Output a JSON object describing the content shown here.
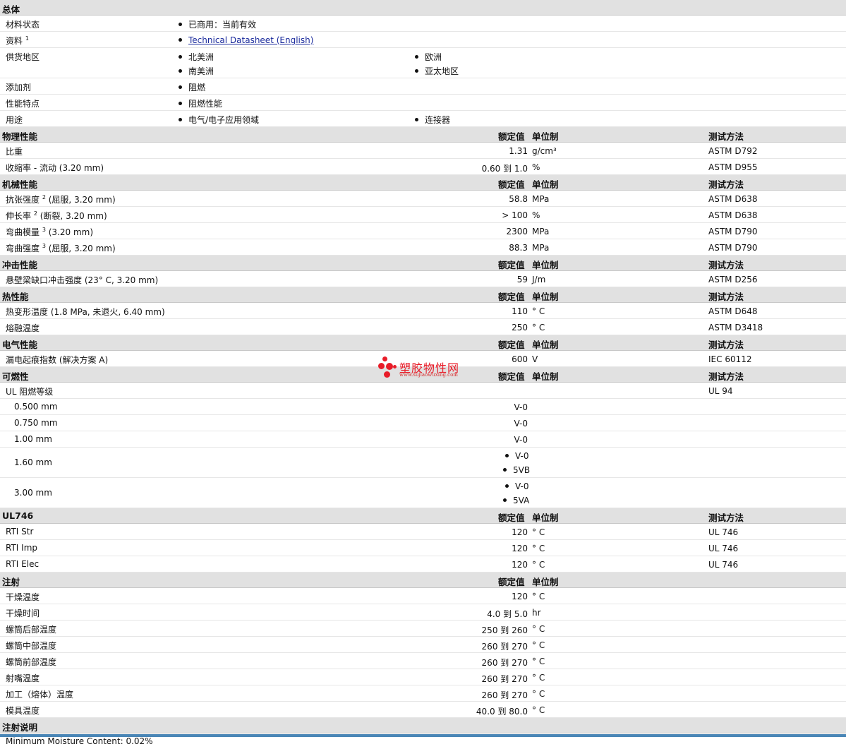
{
  "general": {
    "title": "总体",
    "status_label": "材料状态",
    "status_value": "已商用：当前有效",
    "docs_label": "资料",
    "docs_note": "1",
    "docs_link": "Technical Datasheet (English)",
    "supply_label": "供货地区",
    "supply": [
      "北美洲",
      "欧洲",
      "南美洲",
      "亚太地区"
    ],
    "additive_label": "添加剂",
    "additive_value": "阻燃",
    "feature_label": "性能特点",
    "feature_value": "阻燃性能",
    "use_label": "用途",
    "use_values": [
      "电气/电子应用领域",
      "连接器"
    ]
  },
  "headers": {
    "rated": "额定值",
    "unit": "单位制",
    "test": "测试方法"
  },
  "physical": {
    "title": "物理性能",
    "rows": [
      {
        "label": "比重",
        "value": "1.31",
        "unit": "g/cm³",
        "test": "ASTM D792"
      },
      {
        "label": "收缩率 - 流动  (3.20 mm)",
        "value": "0.60 到  1.0",
        "unit": "%",
        "test": "ASTM D955"
      }
    ]
  },
  "mechanical": {
    "title": "机械性能",
    "rows": [
      {
        "label_a": "抗张强度",
        "note": "2",
        "label_b": " (屈服, 3.20 mm)",
        "value": "58.8",
        "unit": "MPa",
        "test": "ASTM D638"
      },
      {
        "label_a": "伸长率",
        "note": "2",
        "label_b": " (断裂, 3.20 mm)",
        "value": "> 100",
        "unit": "%",
        "test": "ASTM D638"
      },
      {
        "label_a": "弯曲模量",
        "note": "3",
        "label_b": " (3.20 mm)",
        "value": "2300",
        "unit": "MPa",
        "test": "ASTM D790"
      },
      {
        "label_a": "弯曲强度",
        "note": "3",
        "label_b": " (屈服, 3.20 mm)",
        "value": "88.3",
        "unit": "MPa",
        "test": "ASTM D790"
      }
    ]
  },
  "impact": {
    "title": "冲击性能",
    "rows": [
      {
        "label": "悬壁梁缺口冲击强度  (23°  C, 3.20 mm)",
        "value": "59",
        "unit": "J/m",
        "test": "ASTM D256"
      }
    ]
  },
  "thermal": {
    "title": "热性能",
    "rows": [
      {
        "label": "热变形温度  (1.8 MPa, 未退火, 6.40 mm)",
        "value": "110",
        "unit": "°  C",
        "test": "ASTM D648"
      },
      {
        "label": "熔融温度",
        "value": "250",
        "unit": "°  C",
        "test": "ASTM D3418"
      }
    ]
  },
  "electrical": {
    "title": "电气性能",
    "rows": [
      {
        "label": "漏电起痕指数  (解决方案  A)",
        "value": "600",
        "unit": "V",
        "test": "IEC 60112"
      }
    ]
  },
  "flammability": {
    "title": "可燃性",
    "main_label": "UL 阻燃等级",
    "main_test": "UL 94",
    "rows": [
      {
        "label": "0.500 mm",
        "value": "V-0"
      },
      {
        "label": "0.750 mm",
        "value": "V-0"
      },
      {
        "label": "1.00 mm",
        "value": "V-0"
      },
      {
        "label": "1.60 mm",
        "values": [
          "V-0",
          "5VB"
        ]
      },
      {
        "label": "3.00 mm",
        "values": [
          "V-0",
          "5VA"
        ]
      }
    ]
  },
  "ul746": {
    "title": "UL746",
    "rows": [
      {
        "label": "RTI Str",
        "value": "120",
        "unit": "°  C",
        "test": "UL 746"
      },
      {
        "label": "RTI Imp",
        "value": "120",
        "unit": "°  C",
        "test": "UL 746"
      },
      {
        "label": "RTI Elec",
        "value": "120",
        "unit": "°  C",
        "test": "UL 746"
      }
    ]
  },
  "injection": {
    "title": "注射",
    "rows": [
      {
        "label": "干燥温度",
        "value": "120",
        "unit": "°  C"
      },
      {
        "label": "干燥时间",
        "value": "4.0 到  5.0",
        "unit": "hr"
      },
      {
        "label": "螺筒后部温度",
        "value": "250 到  260",
        "unit": "°  C"
      },
      {
        "label": "螺筒中部温度",
        "value": "260 到  270",
        "unit": "°  C"
      },
      {
        "label": "螺筒前部温度",
        "value": "260 到  270",
        "unit": "°  C"
      },
      {
        "label": "射嘴温度",
        "value": "260 到  270",
        "unit": "°  C"
      },
      {
        "label": "加工（熔体）温度",
        "value": "260 到  270",
        "unit": "°  C"
      },
      {
        "label": "模具温度",
        "value": "40.0 到  80.0",
        "unit": "°  C"
      }
    ]
  },
  "notes": {
    "title": "注射说明",
    "text": "Minimum Moisture Content: 0.02%"
  },
  "watermark": {
    "brand": "塑胶物性网",
    "url": "www.sujiaowuxing.com",
    "color": "#e81c28"
  }
}
